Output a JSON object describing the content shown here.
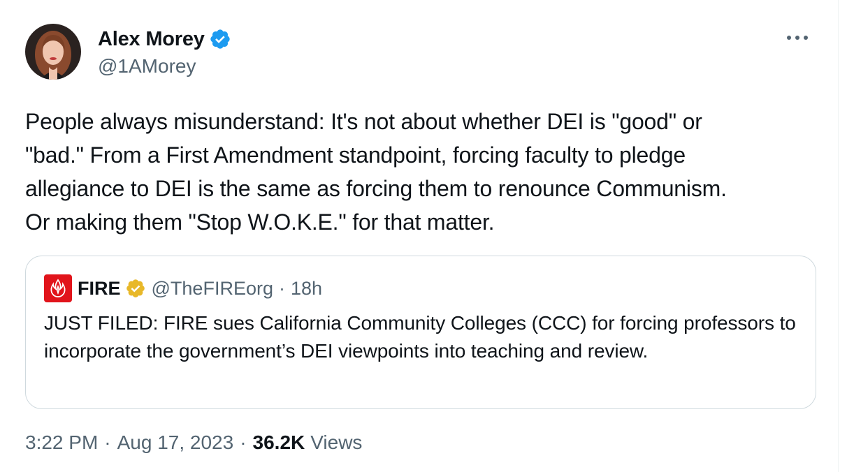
{
  "author": {
    "display_name": "Alex Morey",
    "handle": "@1AMorey",
    "verified_color": "#1d9bf0"
  },
  "tweet": {
    "text": "People always misunderstand: It's not about whether DEI is \"good\" or\n\"bad.\" From a First Amendment standpoint, forcing faculty to pledge\nallegiance to DEI is the same as forcing them to renounce Communism.\nOr making them \"Stop W.O.K.E.\" for that matter.",
    "time": "3:22 PM",
    "date": "Aug 17, 2023",
    "views_count": "36.2K",
    "views_label": "Views"
  },
  "quoted_tweet": {
    "name": "FIRE",
    "handle": "@TheFIREorg",
    "separator": "·",
    "age": "18h",
    "text": "JUST FILED: FIRE sues California Community Colleges (CCC) for forcing professors to incorporate the government’s DEI viewpoints into teaching and review.",
    "badge_color": "#e8b829",
    "logo_color": "#e1141b"
  },
  "meta_separator": "·",
  "icons": {
    "more": "more-horizontal-icon",
    "verified": "verified-badge-icon",
    "org_badge": "gold-verified-badge-icon",
    "org_logo": "fire-logo-icon"
  }
}
